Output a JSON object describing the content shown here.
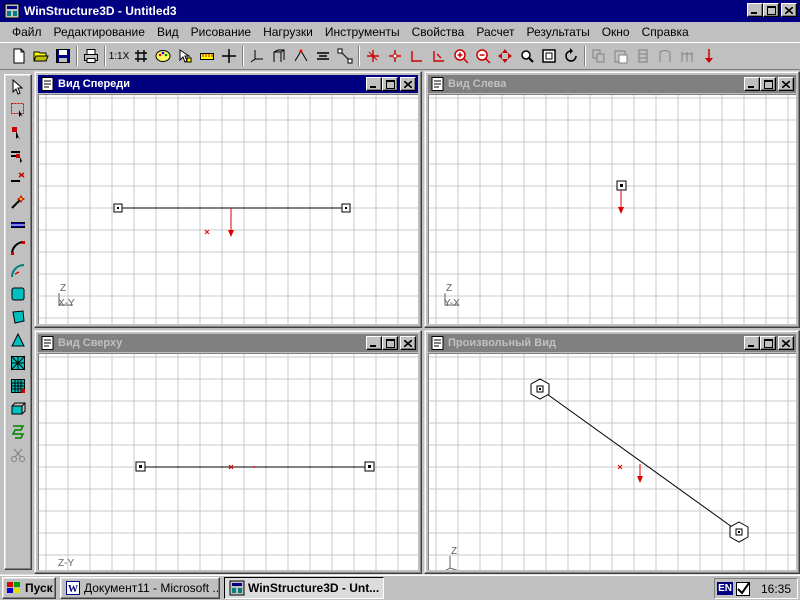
{
  "window": {
    "title": "WinStructure3D - Untitled3"
  },
  "menu": {
    "items": [
      {
        "label": "Файл"
      },
      {
        "label": "Редактирование"
      },
      {
        "label": "Вид"
      },
      {
        "label": "Рисование"
      },
      {
        "label": "Нагрузки"
      },
      {
        "label": "Инструменты"
      },
      {
        "label": "Свойства"
      },
      {
        "label": "Расчет"
      },
      {
        "label": "Результаты"
      },
      {
        "label": "Окно"
      },
      {
        "label": "Справка"
      }
    ]
  },
  "toolbar": {
    "scale_label": "1:1X"
  },
  "views": {
    "front": {
      "title": "Вид Спереди",
      "axis_primary": "Z",
      "axis_secondary": "X-Y",
      "active": true
    },
    "left": {
      "title": "Вид Слева",
      "axis_primary": "Z",
      "axis_secondary": "Y-X",
      "active": false
    },
    "top": {
      "title": "Вид Сверху",
      "axis_primary": "Z-Y",
      "axis_secondary": "",
      "active": false
    },
    "arbitrary": {
      "title": "Произвольный Вид",
      "axis_primary": "Z",
      "axis_secondary": "",
      "active": false
    }
  },
  "taskbar": {
    "start_label": "Пуск",
    "tasks": [
      {
        "label": "Документ11 - Microsoft ...",
        "active": false
      },
      {
        "label": "WinStructure3D - Unt...",
        "active": true
      }
    ],
    "language": "EN",
    "clock": "16:35"
  },
  "colors": {
    "titlebar_active": "#000080",
    "titlebar_inactive": "#808080",
    "face": "#c0c0c0",
    "grid": "#c8c8c8",
    "load_arrow": "#e00000",
    "desktop": "#008080"
  }
}
